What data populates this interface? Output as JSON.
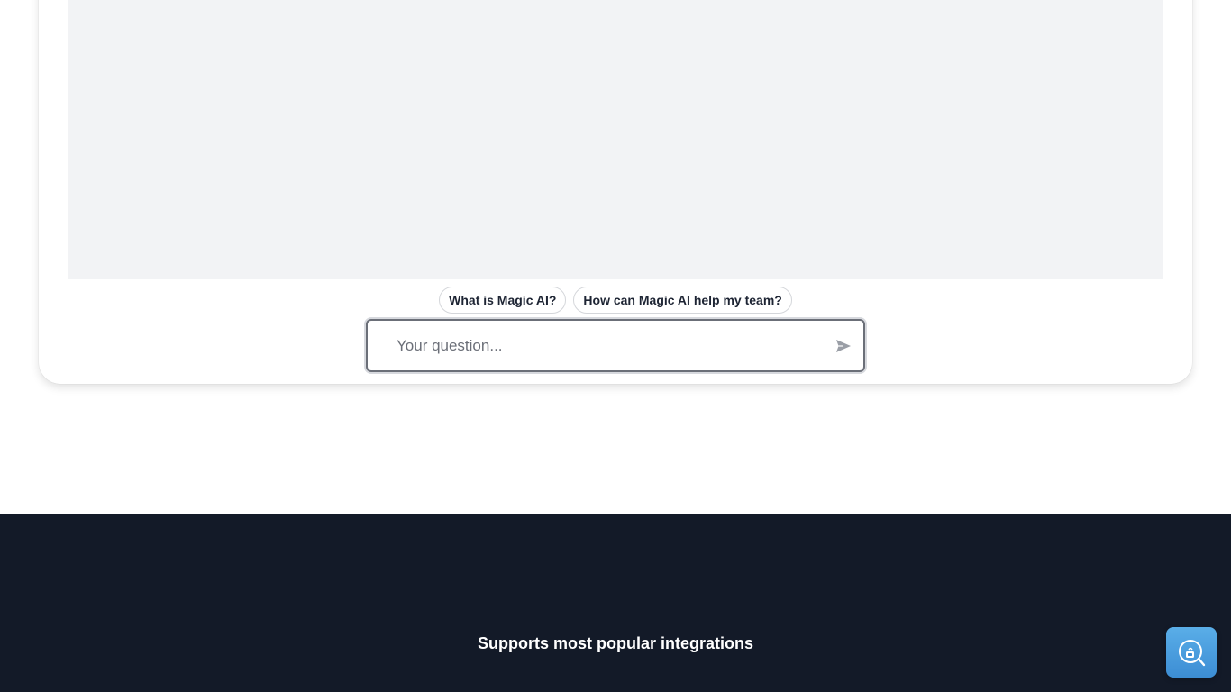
{
  "chat": {
    "suggestions": [
      {
        "label": "What is Magic AI?"
      },
      {
        "label": "How can Magic AI help my team?"
      }
    ],
    "input": {
      "placeholder": "Your question...",
      "value": ""
    },
    "send_icon": "send-icon"
  },
  "integrations": {
    "heading": "Supports most popular integrations"
  },
  "widget": {
    "icon": "chat-support-icon"
  },
  "colors": {
    "dark_section_bg": "#131a28",
    "chat_area_bg": "#f2f3f5",
    "widget_accent": "#4a9fe0"
  }
}
